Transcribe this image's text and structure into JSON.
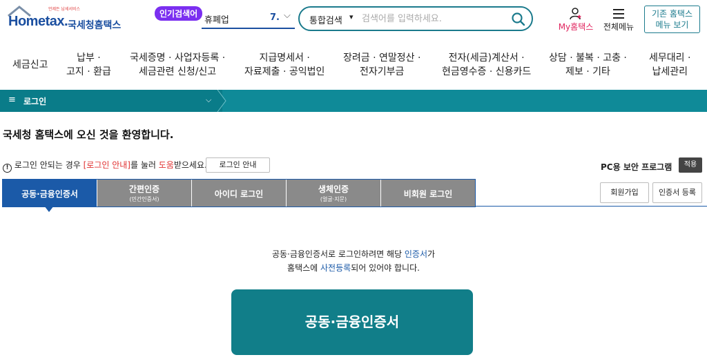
{
  "header": {
    "logo_tagline": "언제든 납세서비스",
    "logo_brand": "Hometax.",
    "logo_org": "국세청홈택스",
    "popular_badge": "인기검색어",
    "popular_term": "휴폐업",
    "popular_rank": "7.",
    "search_scope": "통합검색",
    "search_placeholder": "검색어를 입력하세요.",
    "my_hometax": "My홈택스",
    "all_menu": "전체메뉴",
    "classic_line1": "기존 홈택스",
    "classic_line2": "메뉴 보기"
  },
  "nav": [
    {
      "line1": "세금신고",
      "line2": ""
    },
    {
      "line1": "납부 ·",
      "line2": "고지 · 환급"
    },
    {
      "line1": "국세증명 · 사업자등록 ·",
      "line2": "세금관련 신청/신고"
    },
    {
      "line1": "지급명세서 ·",
      "line2": "자료제출 · 공익법인"
    },
    {
      "line1": "장려금 · 연말정산 ·",
      "line2": "전자기부금"
    },
    {
      "line1": "전자(세금)계산서 ·",
      "line2": "현금영수증 · 신용카드"
    },
    {
      "line1": "상담 · 불복 · 고충 ·",
      "line2": "제보 · 기타"
    },
    {
      "line1": "세무대리 ·",
      "line2": "납세관리"
    }
  ],
  "breadcrumb": {
    "label": "로그인"
  },
  "welcome": "국세청 홈택스에 오신 것을 환영합니다.",
  "notice": {
    "prefix": "로그인 안되는 경우 ",
    "link": "[로그인 안내]",
    "middle": "를 눌러 ",
    "help": "도움",
    "suffix": "받으세요.",
    "guide_button": "로그인 안내"
  },
  "pc_security": "PC용 보안 프로그램",
  "apply_button": "적용",
  "tabs": [
    {
      "label": "공동·금융인증서",
      "sub": ""
    },
    {
      "label": "간편인증",
      "sub": "(민간인증서)"
    },
    {
      "label": "아이디 로그인",
      "sub": ""
    },
    {
      "label": "생체인증",
      "sub": "(얼굴·지문)"
    },
    {
      "label": "비회원 로그인",
      "sub": ""
    }
  ],
  "signup_button": "회원가입",
  "cert_register_button": "인증서 등록",
  "info": {
    "l1_a": "공동·금융인증서로 로그인하려면 해당 ",
    "l1_b": "인증서",
    "l1_c": "가",
    "l2_a": "홈택스에 ",
    "l2_b": "사전등록",
    "l2_c": "되어 있어야 합니다."
  },
  "cert_button": "공동·금융인증서"
}
